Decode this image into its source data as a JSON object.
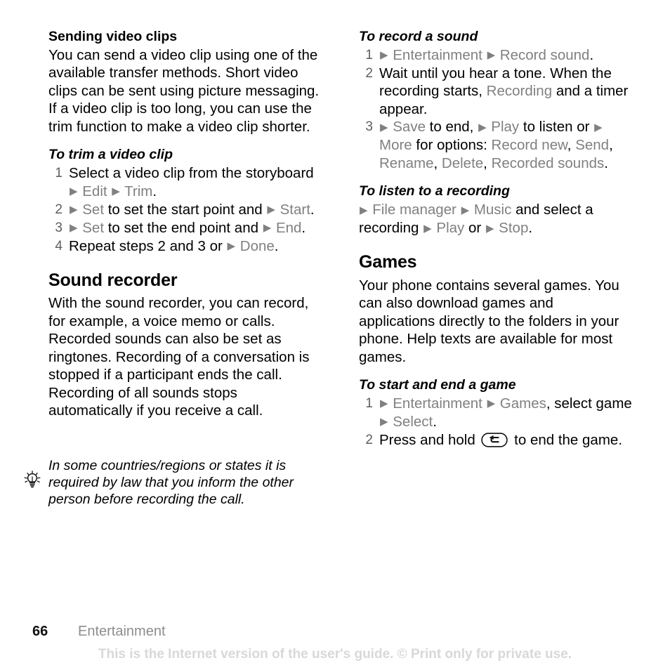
{
  "page": {
    "folio": "66",
    "running_head": "Entertainment",
    "disclaimer": "This is the Internet version of the user's guide. © Print only for private use.",
    "menu_color": "#808080",
    "text_color": "#000000",
    "number_color": "#5e5e5e",
    "disclaimer_color": "#d8d8d8",
    "running_head_color": "#8d8d8d"
  },
  "left_column": {
    "section_sending": {
      "heading": "Sending video clips",
      "body": "You can send a video clip using one of the available transfer methods. Short video clips can be sent using picture messaging. If a video clip is too long, you can use the trim function to make a video clip shorter."
    },
    "proc_trim": {
      "heading": "To trim a video clip",
      "steps": [
        {
          "num": "1",
          "parts": [
            {
              "t": "Select a video clip from the storyboard ",
              "k": "plain"
            },
            {
              "t": "▶",
              "k": "arrow"
            },
            {
              "t": " Edit ",
              "k": "menu"
            },
            {
              "t": "▶",
              "k": "arrow"
            },
            {
              "t": " Trim",
              "k": "menu"
            },
            {
              "t": ".",
              "k": "plain"
            }
          ]
        },
        {
          "num": "2",
          "parts": [
            {
              "t": "▶",
              "k": "arrow"
            },
            {
              "t": " Set ",
              "k": "menu"
            },
            {
              "t": "to set the start point and ",
              "k": "plain"
            },
            {
              "t": "▶",
              "k": "arrow"
            },
            {
              "t": " Start",
              "k": "menu"
            },
            {
              "t": ".",
              "k": "plain"
            }
          ]
        },
        {
          "num": "3",
          "parts": [
            {
              "t": "▶",
              "k": "arrow"
            },
            {
              "t": " Set ",
              "k": "menu"
            },
            {
              "t": "to set the end point and ",
              "k": "plain"
            },
            {
              "t": "▶",
              "k": "arrow"
            },
            {
              "t": " End",
              "k": "menu"
            },
            {
              "t": ".",
              "k": "plain"
            }
          ]
        },
        {
          "num": "4",
          "parts": [
            {
              "t": "Repeat steps 2 and 3 or ",
              "k": "plain"
            },
            {
              "t": "▶",
              "k": "arrow"
            },
            {
              "t": " Done",
              "k": "menu"
            },
            {
              "t": ".",
              "k": "plain"
            }
          ]
        }
      ]
    },
    "section_sound_recorder": {
      "heading": "Sound recorder",
      "body": "With the sound recorder, you can record, for example, a voice memo or calls. Recorded sounds can also be set as ringtones. Recording of a conversation is stopped if a participant ends the call. Recording of all sounds stops automatically if you receive a call."
    },
    "tip": {
      "icon": "lightbulb-tip-icon",
      "text": "In some countries/regions or states it is required by law that you inform the other person before recording the call."
    }
  },
  "right_column": {
    "proc_record_sound": {
      "heading": "To record a sound",
      "steps": [
        {
          "num": "1",
          "parts": [
            {
              "t": "▶",
              "k": "arrow"
            },
            {
              "t": " Entertainment ",
              "k": "menu"
            },
            {
              "t": "▶",
              "k": "arrow"
            },
            {
              "t": " Record sound",
              "k": "menu"
            },
            {
              "t": ".",
              "k": "plain"
            }
          ]
        },
        {
          "num": "2",
          "parts": [
            {
              "t": "Wait until you hear a tone. When the recording starts, ",
              "k": "plain"
            },
            {
              "t": "Recording",
              "k": "menu"
            },
            {
              "t": " and a timer appear.",
              "k": "plain"
            }
          ]
        },
        {
          "num": "3",
          "parts": [
            {
              "t": "▶",
              "k": "arrow"
            },
            {
              "t": " Save ",
              "k": "menu"
            },
            {
              "t": "to end, ",
              "k": "plain"
            },
            {
              "t": "▶",
              "k": "arrow"
            },
            {
              "t": " Play ",
              "k": "menu"
            },
            {
              "t": "to listen or ",
              "k": "plain"
            },
            {
              "t": "▶",
              "k": "arrow"
            },
            {
              "t": " More ",
              "k": "menu"
            },
            {
              "t": "for options: ",
              "k": "plain"
            },
            {
              "t": "Record new",
              "k": "menu"
            },
            {
              "t": ", ",
              "k": "plain"
            },
            {
              "t": "Send",
              "k": "menu"
            },
            {
              "t": ", ",
              "k": "plain"
            },
            {
              "t": "Rename",
              "k": "menu"
            },
            {
              "t": ", ",
              "k": "plain"
            },
            {
              "t": "Delete",
              "k": "menu"
            },
            {
              "t": ", ",
              "k": "plain"
            },
            {
              "t": "Recorded sounds",
              "k": "menu"
            },
            {
              "t": ".",
              "k": "plain"
            }
          ]
        }
      ]
    },
    "proc_listen": {
      "heading": "To listen to a recording",
      "body_parts": [
        {
          "t": "▶",
          "k": "arrow"
        },
        {
          "t": " File manager ",
          "k": "menu"
        },
        {
          "t": "▶",
          "k": "arrow"
        },
        {
          "t": " Music ",
          "k": "menu"
        },
        {
          "t": "and select a recording ",
          "k": "plain"
        },
        {
          "t": "▶",
          "k": "arrow"
        },
        {
          "t": " Play ",
          "k": "menu"
        },
        {
          "t": "or ",
          "k": "plain"
        },
        {
          "t": "▶",
          "k": "arrow"
        },
        {
          "t": " Stop",
          "k": "menu"
        },
        {
          "t": ".",
          "k": "plain"
        }
      ]
    },
    "section_games": {
      "heading": "Games",
      "body": "Your phone contains several games. You can also download games and applications directly to the folders in your phone. Help texts are available for most games."
    },
    "proc_start_end_game": {
      "heading": "To start and end a game",
      "steps": [
        {
          "num": "1",
          "parts": [
            {
              "t": "▶",
              "k": "arrow"
            },
            {
              "t": " Entertainment ",
              "k": "menu"
            },
            {
              "t": "▶",
              "k": "arrow"
            },
            {
              "t": " Games",
              "k": "menu"
            },
            {
              "t": ", select game ",
              "k": "plain"
            },
            {
              "t": "▶",
              "k": "arrow"
            },
            {
              "t": " Select",
              "k": "menu"
            },
            {
              "t": ".",
              "k": "plain"
            }
          ]
        },
        {
          "num": "2",
          "parts": [
            {
              "t": "Press and hold ",
              "k": "plain"
            },
            {
              "t": "back-key-icon",
              "k": "keyglyph"
            },
            {
              "t": " to end the game.",
              "k": "plain"
            }
          ]
        }
      ]
    }
  }
}
